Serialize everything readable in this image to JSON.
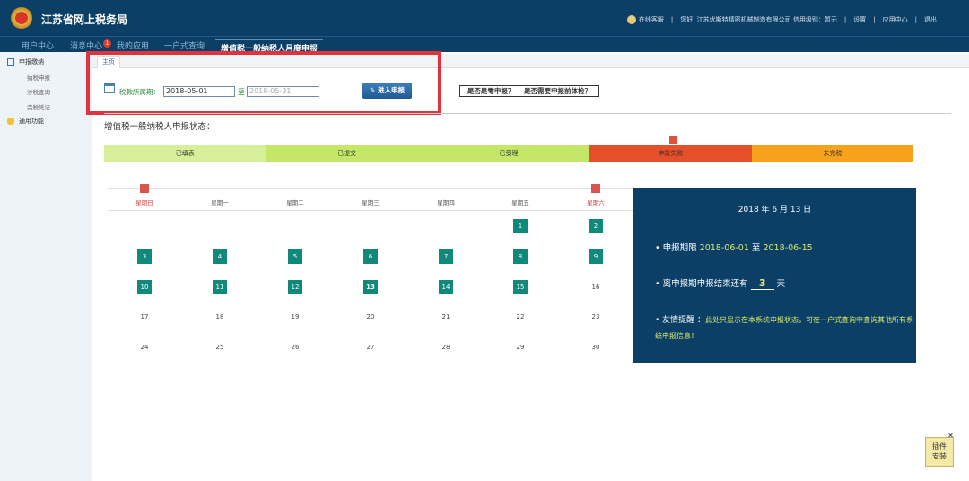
{
  "header": {
    "title": "江苏省网上税务局",
    "online_service": "在线客服",
    "greeting": "您好, 江苏优斯特精密机械制造有限公司 信用级别：暂无",
    "settings": "设置",
    "app_center": "应用中心",
    "logout": "退出"
  },
  "nav": {
    "items": [
      "用户中心",
      "消息中心",
      "我的应用",
      "一户式查询",
      "增值税一般纳税人月度申报"
    ],
    "message_badge": "1"
  },
  "sidebar": {
    "group1": "申报缴纳",
    "sub": [
      "纳税申报",
      "涉税查询",
      "完税凭证"
    ],
    "group2": "通用功能"
  },
  "tabs": {
    "home": "主页"
  },
  "form": {
    "period_label": "税款所属期：",
    "start": "2018-05-01",
    "to": "至",
    "end": "2018-05-31",
    "enter_button": "进入申报",
    "q1": "是否是零申报？",
    "q2": "是否需要申报前体检？"
  },
  "status": {
    "title": "增值税一般纳税人申报状态：",
    "steps": [
      {
        "label": "已填表",
        "color": "#d8ef9a"
      },
      {
        "label": "已提交",
        "color": "#c4e768"
      },
      {
        "label": "已受理",
        "color": "#c4e768"
      },
      {
        "label": "申报失败",
        "color": "#e5502a"
      },
      {
        "label": "未完税",
        "color": "#f8a21c"
      }
    ]
  },
  "calendar": {
    "weekdays": [
      "星期日",
      "星期一",
      "星期二",
      "星期三",
      "星期四",
      "星期五",
      "星期六"
    ],
    "weeks": [
      [
        null,
        null,
        null,
        null,
        null,
        1,
        2
      ],
      [
        3,
        4,
        5,
        6,
        7,
        8,
        9
      ],
      [
        10,
        11,
        12,
        13,
        14,
        15,
        16
      ],
      [
        17,
        18,
        19,
        20,
        21,
        22,
        23
      ],
      [
        24,
        25,
        26,
        27,
        28,
        29,
        30
      ]
    ],
    "highlight_through": 15,
    "today": 13
  },
  "panel": {
    "date": "2018 年 6 月 13 日",
    "period_label": "申报期限",
    "period_start": "2018-06-01",
    "period_to": "至",
    "period_end": "2018-06-15",
    "remaining_prefix": "离申报期申报结束还有",
    "remaining_days": "3",
    "remaining_suffix": "天",
    "tip_label": "友情提醒 ：",
    "tip_text": "此处只显示在本系统申报状态，可在一户式查询中查询其他所有系统申报信息！"
  },
  "plugin": {
    "line1": "插件",
    "line2": "安装",
    "close": "✕"
  }
}
